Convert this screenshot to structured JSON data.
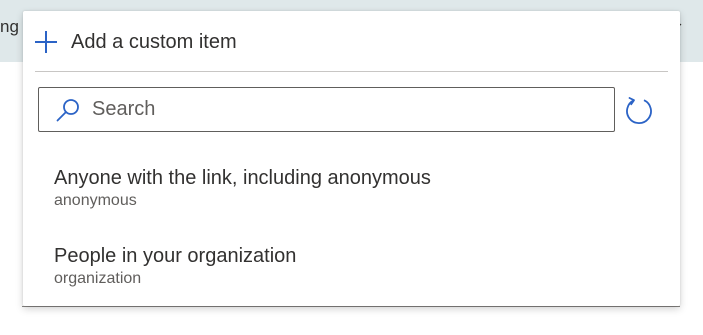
{
  "background": {
    "partial_text": "ng"
  },
  "dropdown": {
    "add_custom_item_label": "Add a custom item",
    "search": {
      "value": "",
      "placeholder": "Search"
    },
    "options": [
      {
        "title": "Anyone with the link, including anonymous",
        "subtitle": "anonymous"
      },
      {
        "title": "People in your organization",
        "subtitle": "organization"
      }
    ]
  },
  "icons": {
    "add": "plus-icon",
    "search": "search-icon",
    "refresh": "refresh-icon",
    "background_dropdown": "chevron-down-icon"
  },
  "colors": {
    "accent": "#2b63c6",
    "background_band": "#dfe8ea",
    "text_primary": "#323130",
    "text_secondary": "#605e5c"
  }
}
